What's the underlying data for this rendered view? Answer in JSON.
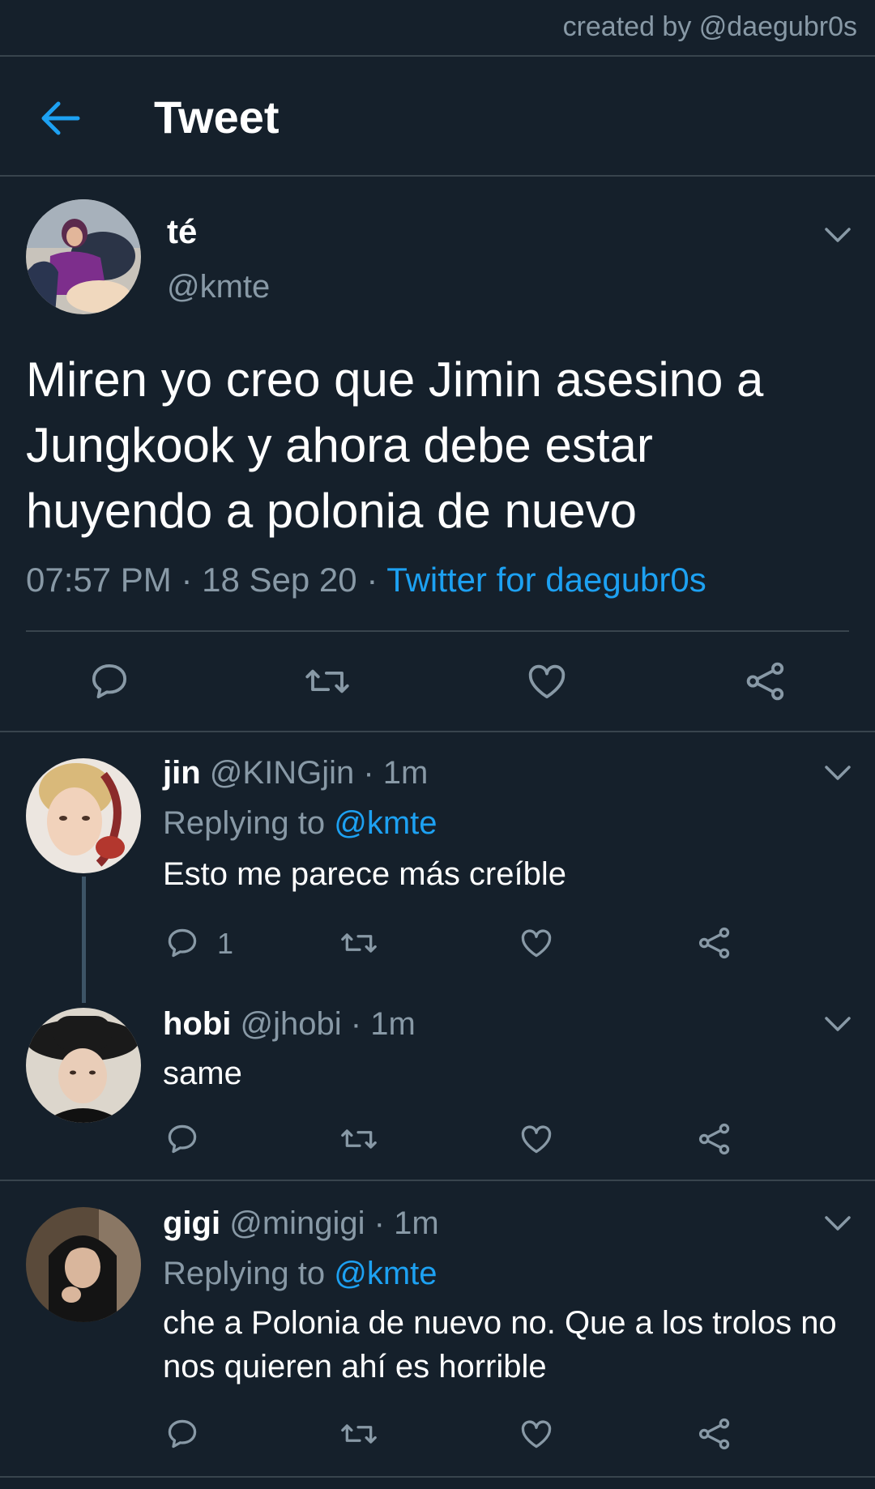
{
  "credit": "created by @daegubr0s",
  "header": {
    "title": "Tweet"
  },
  "tweet": {
    "name": "té",
    "handle": "@kmte",
    "text": "Miren yo creo que Jimin asesino a Jungkook y ahora debe estar huyendo a polonia de nuevo",
    "time": "07:57 PM",
    "date": "18 Sep 20",
    "source": "Twitter for daegubr0s",
    "sep": "·"
  },
  "replies": [
    {
      "name": "jin",
      "handle": "@KINGjin",
      "age": "1m",
      "replying_prefix": "Replying to",
      "replying_to": "@kmte",
      "text": "Esto me parece más creíble",
      "reply_count": "1"
    },
    {
      "name": "hobi",
      "handle": "@jhobi",
      "age": "1m",
      "text": "same"
    },
    {
      "name": "gigi",
      "handle": "@mingigi",
      "age": "1m",
      "replying_prefix": "Replying to",
      "replying_to": "@kmte",
      "text": "che a Polonia de nuevo no. Que a los trolos no nos quieren ahí es horrible"
    }
  ],
  "icons": {
    "back": "arrow-left-icon",
    "more": "chevron-down-icon",
    "reply": "comment-icon",
    "retweet": "retweet-icon",
    "like": "heart-icon",
    "share": "share-icon"
  },
  "colors": {
    "background": "#15202b",
    "accent": "#1da1f2",
    "muted": "#8899a6",
    "divider": "#38444d"
  }
}
